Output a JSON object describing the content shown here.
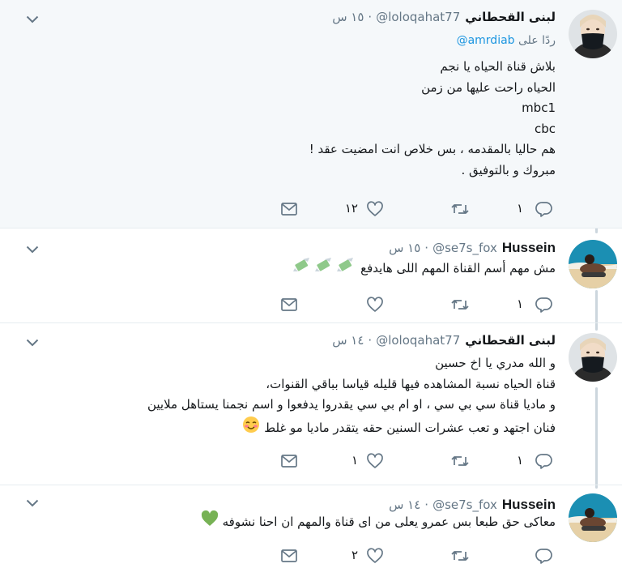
{
  "tweets": [
    {
      "name": "لبنى القحطاني",
      "handle": "@loloqahat77",
      "time": "١٥ س",
      "reply_to_label": "ردًا على",
      "reply_to_handle": "@amrdiab",
      "lines": [
        "بلاش قناة الحياه يا نجم",
        "الحياه راحت عليها من زمن",
        "mbc1",
        "cbc",
        "هم حاليا بالمقدمه ،  بس خلاص انت امضيت عقد !",
        "مبروك و بالتوفيق ."
      ],
      "reply_count": "١",
      "like_count": "١٢",
      "avatar_icon": "woman-mask-avatar"
    },
    {
      "name": "Hussein",
      "handle": "@se7s_fox",
      "time": "١٥ س",
      "lines": [
        "مش مهم أسم القناة المهم اللى هايدفع"
      ],
      "emoji": "money-wings-emoji",
      "reply_count": "١",
      "like_count": "",
      "avatar_icon": "beach-man-avatar"
    },
    {
      "name": "لبنى القحطاني",
      "handle": "@loloqahat77",
      "time": "١٤ س",
      "lines": [
        "و الله مدري يا اخ حسين",
        "قناة الحياه نسبة المشاهده فيها قليله قياسا بباقي القنوات،",
        "و ماديا قناة سي بي سي ، او ام بي سي يقدروا يدفعوا و اسم نجمنا يستاهل ملايين",
        "فنان اجتهد و تعب عشرات السنين حقه يتقدر ماديا مو غلط"
      ],
      "emoji": "smiling-blush-emoji",
      "reply_count": "١",
      "like_count": "١",
      "avatar_icon": "woman-mask-avatar"
    },
    {
      "name": "Hussein",
      "handle": "@se7s_fox",
      "time": "١٤ س",
      "lines": [
        "معاكى حق طبعا  بس عمرو يعلى من اى قناة والمهم ان احنا نشوفه"
      ],
      "emoji": "green-heart-emoji",
      "reply_count": "",
      "like_count": "٢",
      "avatar_icon": "beach-man-avatar"
    }
  ],
  "icons": {
    "caret": "chevron-down-icon",
    "reply": "reply-icon",
    "retweet": "retweet-icon",
    "like": "heart-icon",
    "message": "envelope-icon"
  },
  "colors": {
    "text": "#14171a",
    "muted": "#657786",
    "link": "#1b95e0",
    "highlight_bg": "#f5f8fa",
    "thread_line": "#ccd6dd"
  }
}
